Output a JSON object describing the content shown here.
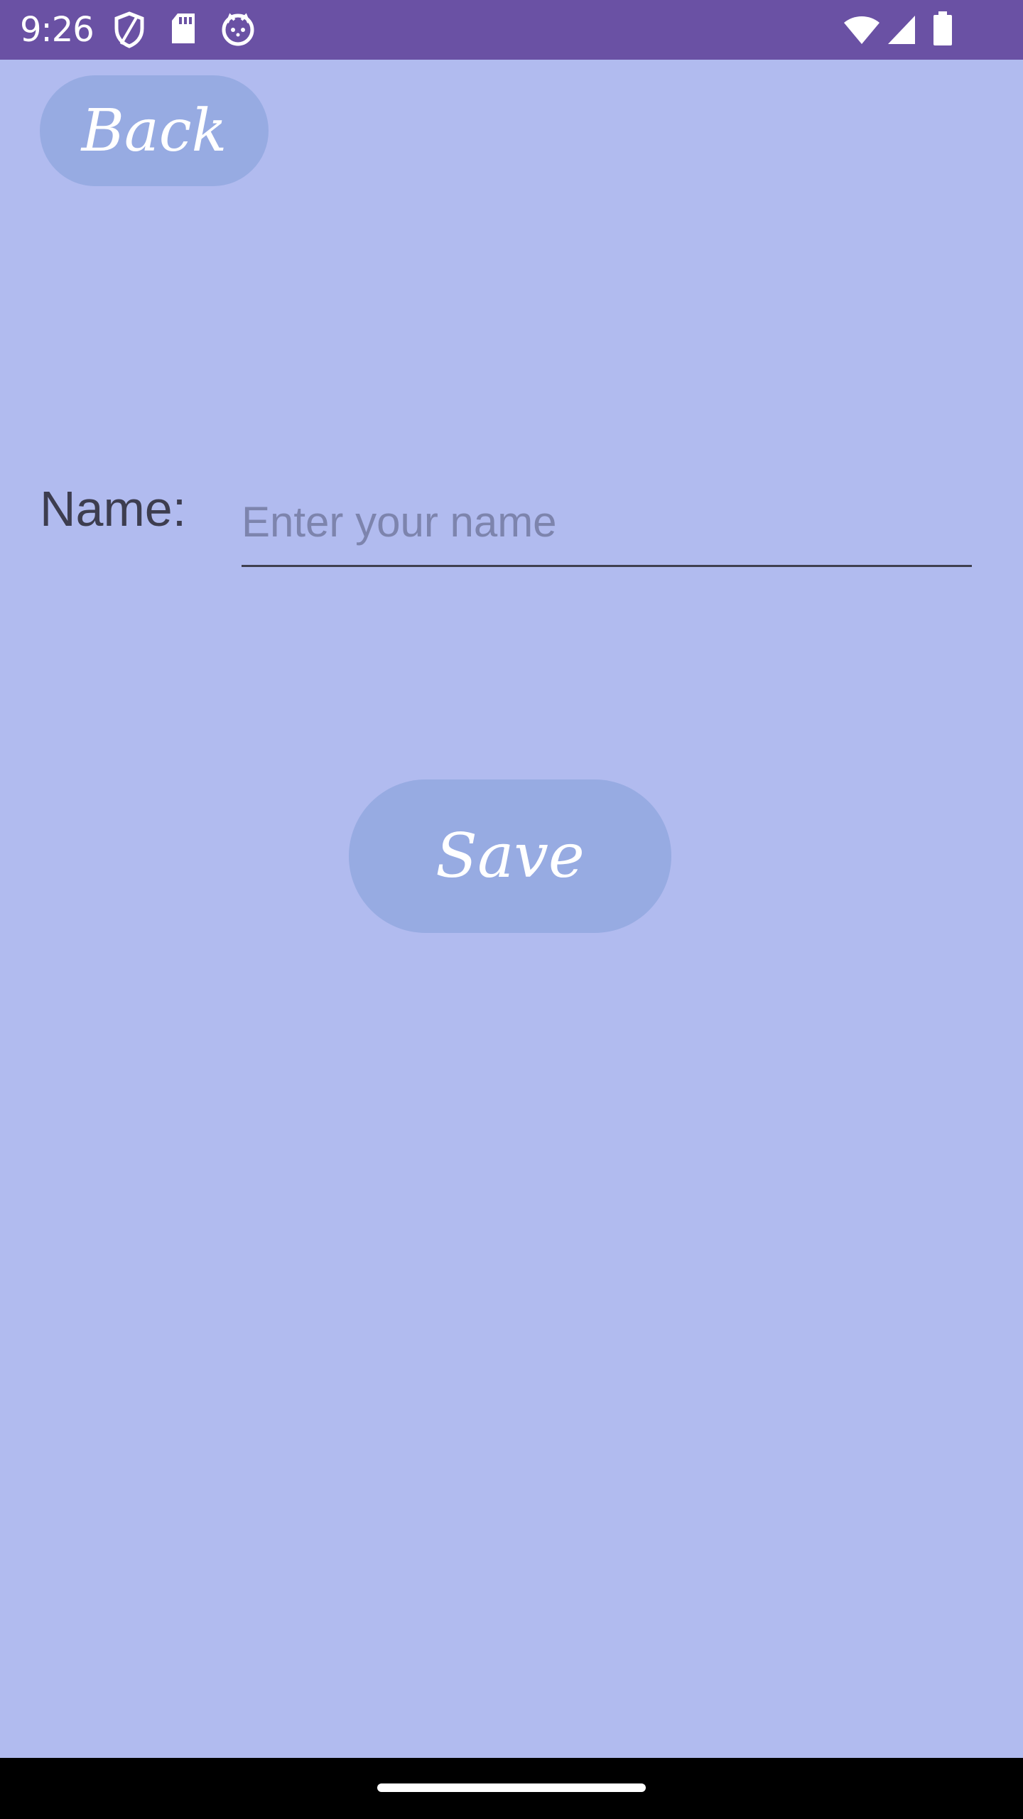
{
  "status_bar": {
    "time": "9:26",
    "icons_left": [
      "shield-icon",
      "sd-card-icon",
      "cat-face-icon"
    ],
    "icons_right": [
      "wifi-icon",
      "cell-signal-icon",
      "battery-icon"
    ],
    "color": "#6a51a4"
  },
  "screen": {
    "background": "#b1bbef",
    "back_button": {
      "label": "Back"
    },
    "name_label": "Name:",
    "name_input": {
      "value": "",
      "placeholder": "Enter your name"
    },
    "save_button": {
      "label": "Save"
    },
    "button_color": "#97abe2"
  },
  "nav_bar": {
    "gesture_handle": "home-indicator"
  }
}
